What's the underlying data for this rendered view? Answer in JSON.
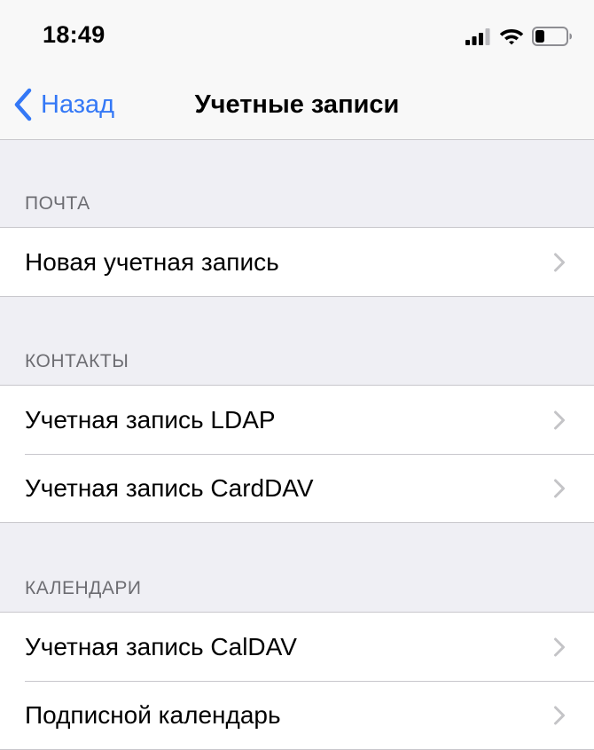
{
  "status_bar": {
    "time": "18:49"
  },
  "nav": {
    "back_label": "Назад",
    "title": "Учетные записи"
  },
  "sections": [
    {
      "header": "ПОЧТА",
      "items": [
        {
          "label": "Новая учетная запись"
        }
      ]
    },
    {
      "header": "КОНТАКТЫ",
      "items": [
        {
          "label": "Учетная запись LDAP"
        },
        {
          "label": "Учетная запись CardDAV"
        }
      ]
    },
    {
      "header": "КАЛЕНДАРИ",
      "items": [
        {
          "label": "Учетная запись CalDAV"
        },
        {
          "label": "Подписной календарь"
        }
      ]
    }
  ],
  "colors": {
    "accent": "#3478f6",
    "background": "#efeff4",
    "separator": "#c8c7cc",
    "section_header": "#6d6d72",
    "chevron": "#c4c4c7"
  },
  "icons": {
    "back": "chevron-left-icon",
    "row_disclosure": "chevron-right-icon",
    "signal": "signal-icon",
    "wifi": "wifi-icon",
    "battery": "battery-icon"
  },
  "battery": {
    "level": 0.3
  }
}
